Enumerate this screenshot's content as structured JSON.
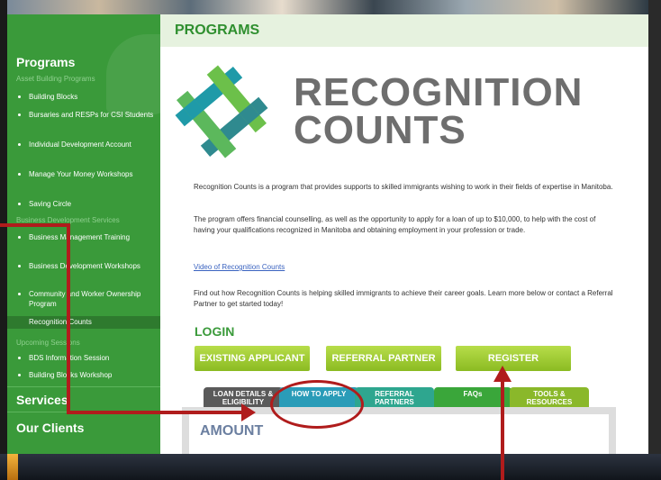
{
  "sidebar": {
    "programs_heading": "Programs",
    "asset_building_label": "Asset Building Programs",
    "items_asset": [
      "Building Blocks",
      "Bursaries and RESPs for CSI Students",
      "Individual Development Account",
      "Manage Your Money Workshops",
      "Saving Circle"
    ],
    "business_label": "Business Development Services",
    "items_business": [
      "Business Management Training",
      "Business Development Workshops",
      "Community and Worker Ownership Program"
    ],
    "active_item": "Recognition Counts",
    "upcoming_label": "Upcoming Sessions",
    "items_upcoming": [
      "BDS Information Session",
      "Building Blocks Workshop"
    ],
    "services": "Services",
    "clients": "Our Clients"
  },
  "header": {
    "title": "PROGRAMS"
  },
  "logo": {
    "line1": "RECOGNITION",
    "line2": "COUNTS"
  },
  "content": {
    "para1": "Recognition Counts is a program that provides supports to skilled immigrants wishing to work in their fields of expertise in Manitoba.",
    "para2": "The program offers financial counselling, as well as the opportunity to apply for a loan of up to $10,000, to help with the cost of having your qualifications recognized in Manitoba and obtaining employment in your profession or trade.",
    "video_link": "Video of Recognition Counts",
    "para3": "Find out how Recognition Counts is helping skilled immigrants to achieve their career goals. Learn more below or contact a Referral Partner to get started today!",
    "login_heading": "LOGIN",
    "btn_existing": "EXISTING APPLICANT",
    "btn_referral": "REFERRAL PARTNER",
    "btn_register": "REGISTER"
  },
  "tabs": [
    {
      "label": "LOAN DETAILS & ELIGIBILITY",
      "color": "#5a5a5a"
    },
    {
      "label": "HOW TO APPLY",
      "color": "#2a9cb8"
    },
    {
      "label": "REFERRAL PARTNERS",
      "color": "#2ea68f"
    },
    {
      "label": "FAQs",
      "color": "#3aa63a"
    },
    {
      "label": "TOOLS & RESOURCES",
      "color": "#8ab82a"
    }
  ],
  "amount_heading": "AMOUNT",
  "colors": {
    "sidebar_green": "#3a9a3a",
    "accent_red": "#b01c1c"
  }
}
